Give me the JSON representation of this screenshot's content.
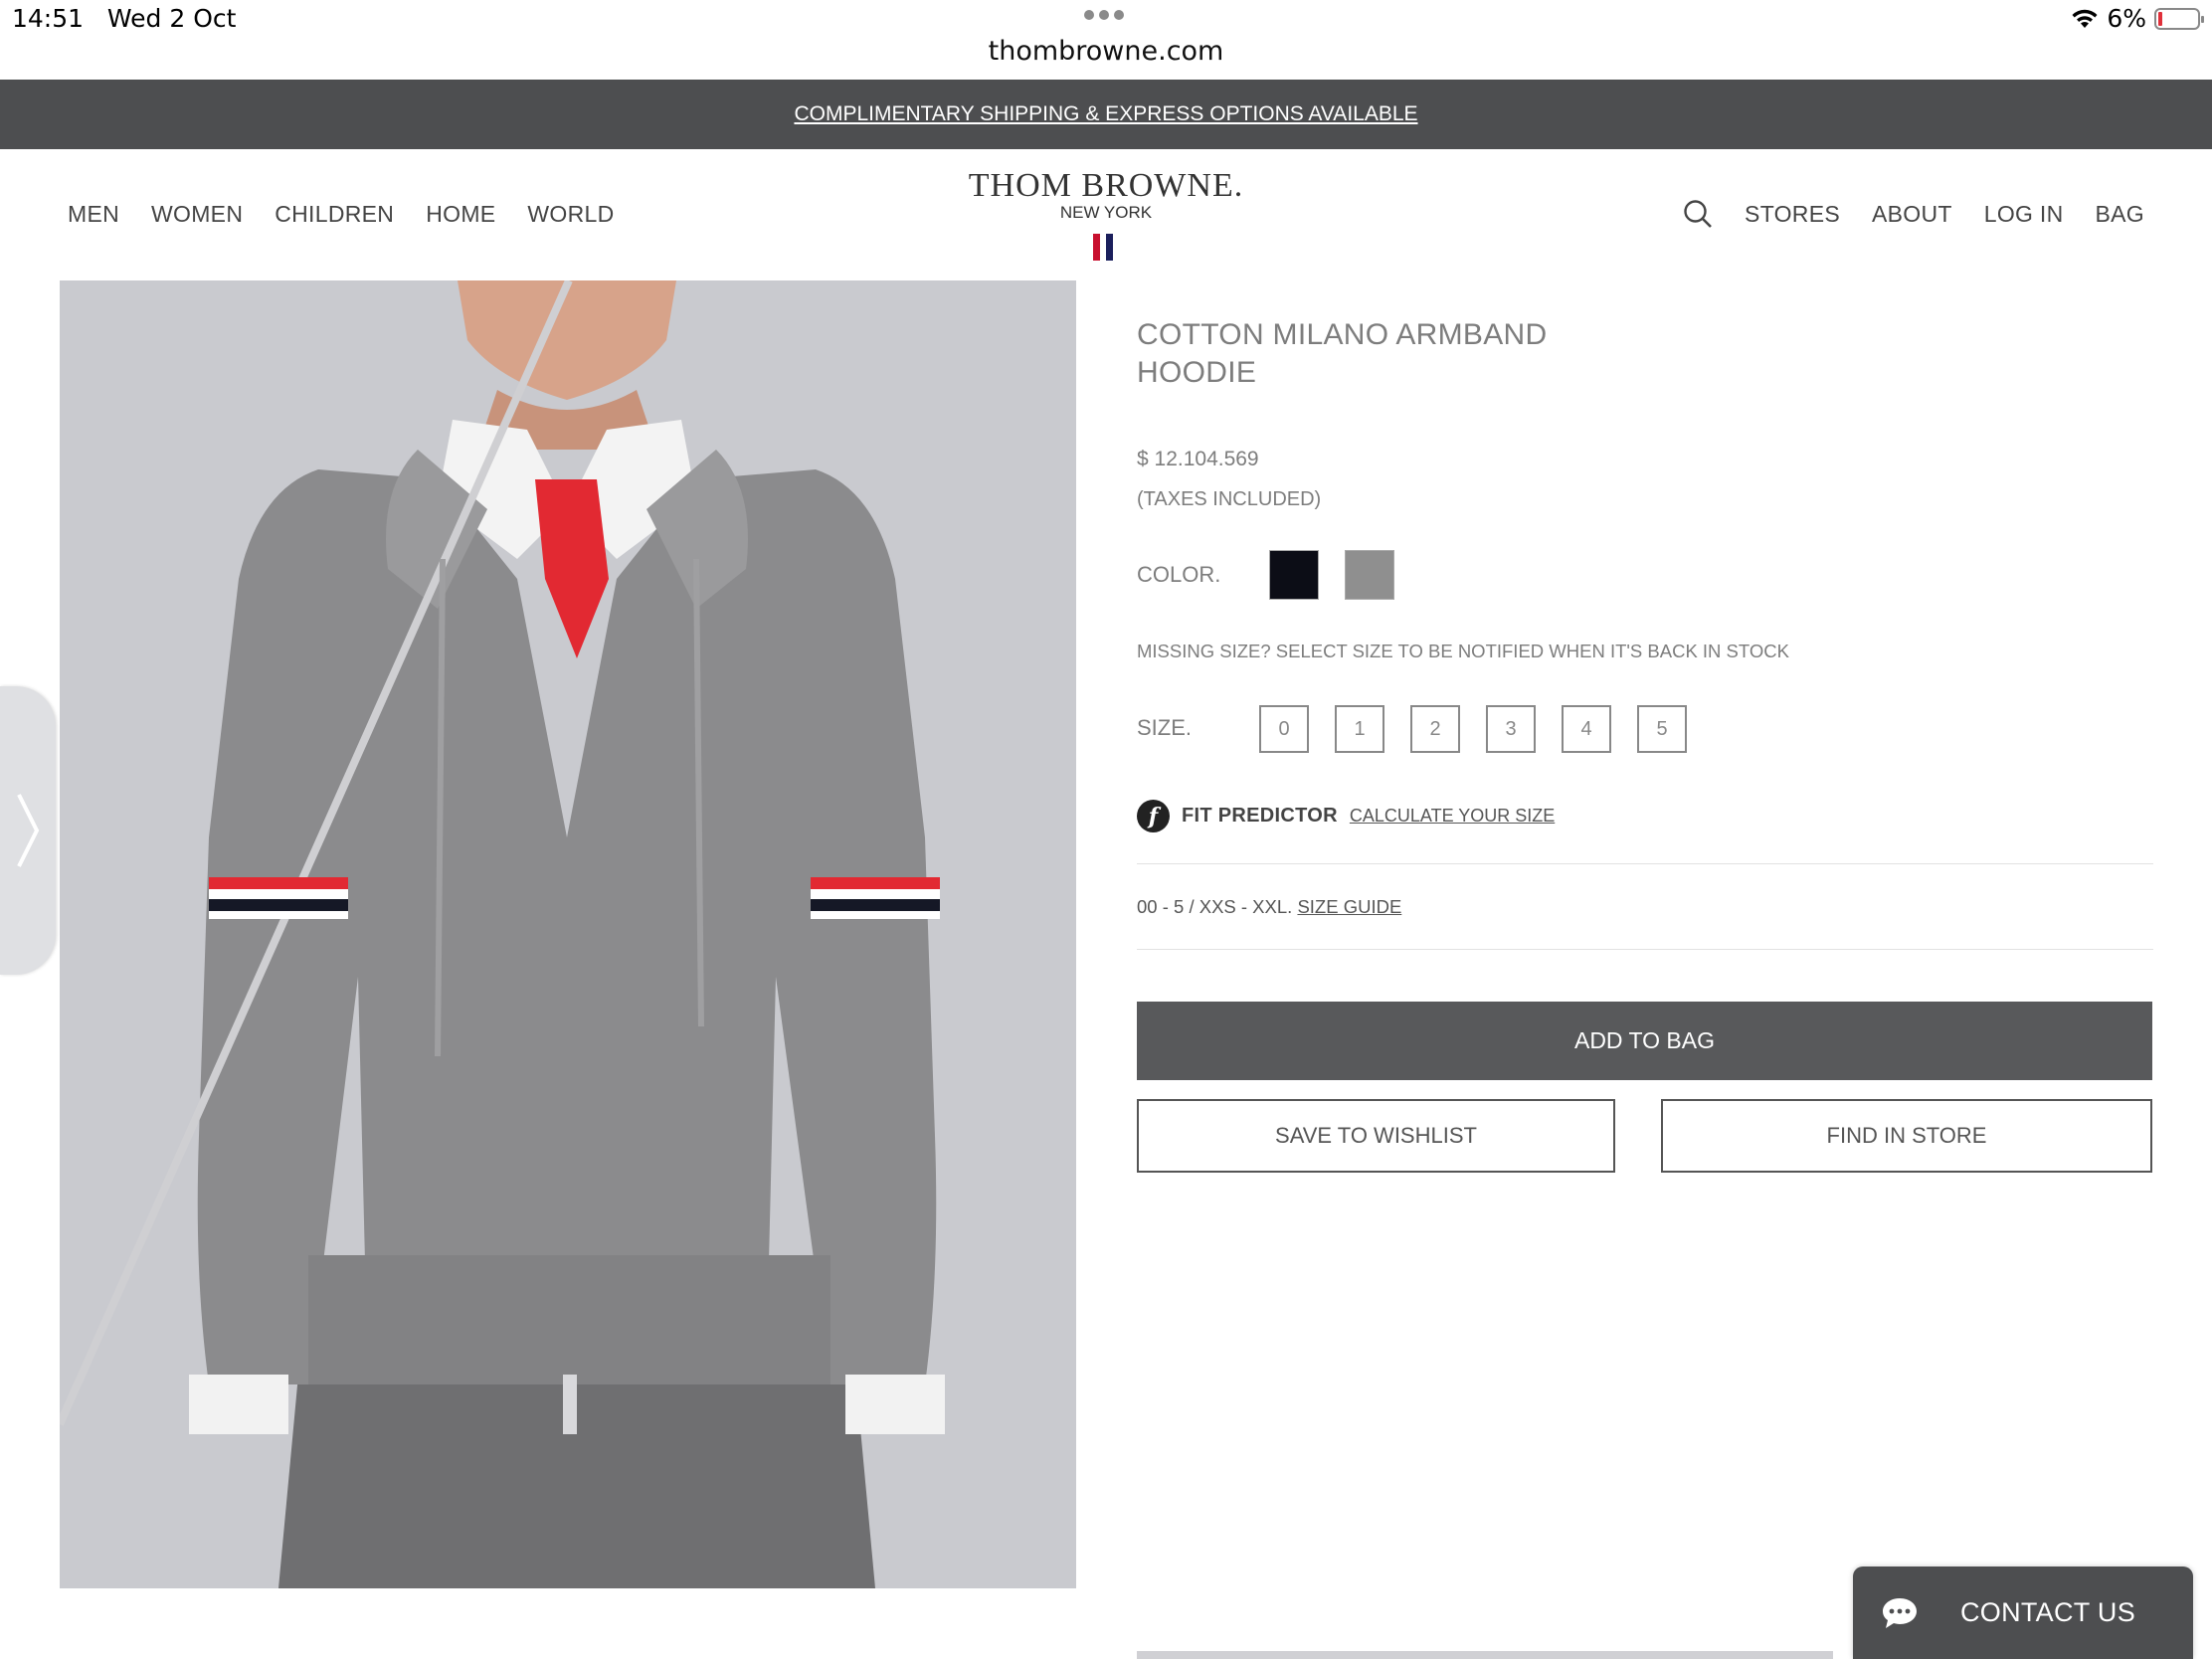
{
  "status_bar": {
    "time": "14:51",
    "date": "Wed 2 Oct",
    "url": "thombrowne.com",
    "battery": "6%"
  },
  "promo": {
    "text": "COMPLIMENTARY SHIPPING & EXPRESS OPTIONS AVAILABLE"
  },
  "header": {
    "nav_left": [
      "MEN",
      "WOMEN",
      "CHILDREN",
      "HOME",
      "WORLD"
    ],
    "logo": "THOM BROWNE.",
    "logo_sub": "NEW YORK",
    "nav_right": [
      "STORES",
      "ABOUT",
      "LOG IN",
      "BAG"
    ]
  },
  "product": {
    "title_line1": "COTTON MILANO ARMBAND",
    "title_line2": "HOODIE",
    "price": "$ 12.104.569",
    "taxes": "(TAXES INCLUDED)",
    "color_label": "COLOR.",
    "colors": [
      {
        "name": "navy",
        "hex": "#0c0d16"
      },
      {
        "name": "grey",
        "hex": "#8f8f8f"
      }
    ],
    "missing_size": "MISSING SIZE? SELECT SIZE TO BE NOTIFIED WHEN IT'S BACK IN STOCK",
    "size_label": "SIZE.",
    "sizes": [
      "0",
      "1",
      "2",
      "3",
      "4",
      "5"
    ],
    "fit_predictor": "FIT PREDICTOR",
    "calculate_link": "CALCULATE YOUR SIZE",
    "size_range": "00 - 5 / XXS - XXL.",
    "size_guide": "SIZE GUIDE",
    "add_to_bag": "ADD TO BAG",
    "save_wishlist": "SAVE TO WISHLIST",
    "find_in_store": "FIND IN STORE"
  },
  "contact": {
    "label": "CONTACT US"
  },
  "colors": {
    "banner_bg": "#4d4e50",
    "button_dark": "#58595b",
    "flag_red": "#c8102e",
    "flag_blue": "#1b1f5c"
  }
}
